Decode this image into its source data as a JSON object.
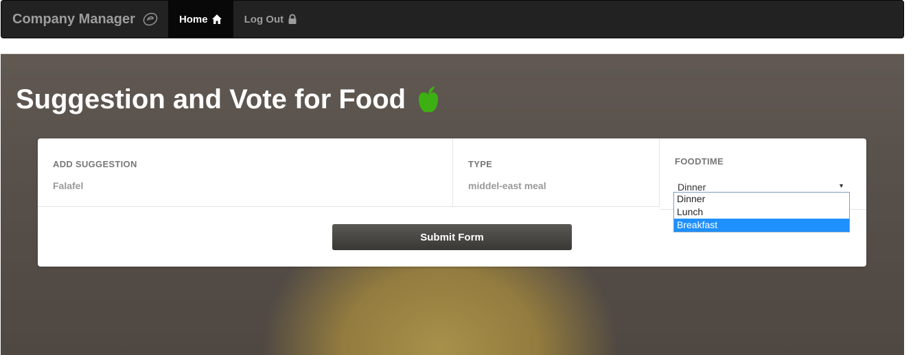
{
  "navbar": {
    "brand": "Company Manager",
    "brand_icon": "e-logo-icon",
    "links": [
      {
        "label": "Home",
        "icon": "home-icon",
        "active": true
      },
      {
        "label": "Log Out",
        "icon": "lock-icon",
        "active": false
      }
    ]
  },
  "hero": {
    "title": "Suggestion and Vote for Food",
    "title_icon": "apple-icon",
    "apple_color": "#3cb012"
  },
  "form": {
    "suggestion": {
      "label": "ADD SUGGESTION",
      "value": "Falafel"
    },
    "type": {
      "label": "TYPE",
      "value": "middel-east meal"
    },
    "foodtime": {
      "label": "FOODTIME",
      "selected": "Dinner",
      "options": [
        "Dinner",
        "Lunch",
        "Breakfast"
      ],
      "highlighted": "Breakfast"
    },
    "submit_label": "Submit Form"
  },
  "colors": {
    "navbar_bg": "#222222",
    "nav_active_bg": "#080808",
    "dropdown_highlight": "#1e90ff",
    "button_bg": "#46443f"
  }
}
